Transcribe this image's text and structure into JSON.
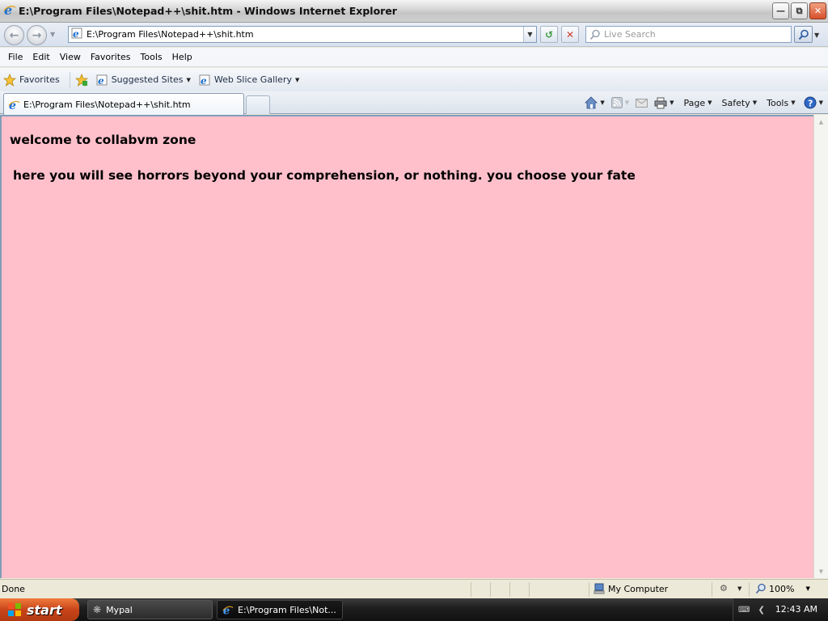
{
  "window": {
    "title": "E:\\Program Files\\Notepad++\\shit.htm - Windows Internet Explorer"
  },
  "address_bar": {
    "url": "E:\\Program Files\\Notepad++\\shit.htm"
  },
  "search": {
    "placeholder": "Live Search"
  },
  "menu": {
    "items": [
      "File",
      "Edit",
      "View",
      "Favorites",
      "Tools",
      "Help"
    ]
  },
  "favorites_bar": {
    "favorites_label": "Favorites",
    "suggested_sites": "Suggested Sites",
    "web_slice_gallery": "Web Slice Gallery"
  },
  "tab": {
    "label": "E:\\Program Files\\Notepad++\\shit.htm"
  },
  "command_bar": {
    "page": "Page",
    "safety": "Safety",
    "tools": "Tools"
  },
  "page": {
    "heading": "welcome to collabvm zone",
    "body": "here you will see horrors beyond your comprehension, or nothing. you choose your fate",
    "background": "#ffc0cb"
  },
  "status_bar": {
    "status": "Done",
    "zone": "My Computer",
    "zoom": "100%"
  },
  "taskbar": {
    "start_label": "start",
    "tasks": [
      "Mypal",
      "E:\\Program Files\\Not..."
    ],
    "clock": "12:43 AM"
  }
}
